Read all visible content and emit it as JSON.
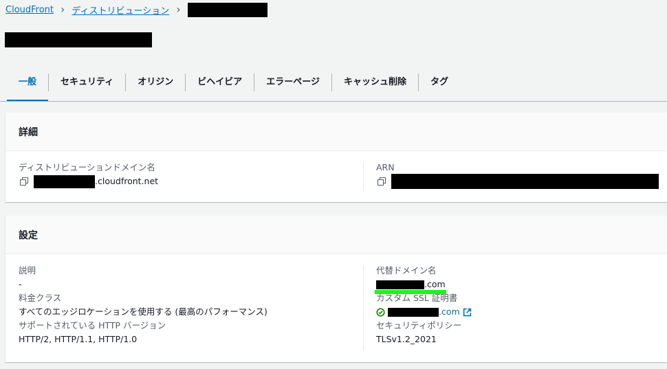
{
  "breadcrumb": {
    "root": "CloudFront",
    "section": "ディストリビューション"
  },
  "tabs": [
    {
      "label": "一般",
      "active": true
    },
    {
      "label": "セキュリティ"
    },
    {
      "label": "オリジン"
    },
    {
      "label": "ビヘイビア"
    },
    {
      "label": "エラーページ"
    },
    {
      "label": "キャッシュ削除"
    },
    {
      "label": "タグ"
    }
  ],
  "details": {
    "header": "詳細",
    "domain_label": "ディストリビューションドメイン名",
    "domain_suffix": ".cloudfront.net",
    "arn_label": "ARN"
  },
  "settings": {
    "header": "設定",
    "description_label": "説明",
    "description_value": "-",
    "price_class_label": "料金クラス",
    "price_class_value": "すべてのエッジロケーションを使用する (最高のパフォーマンス)",
    "http_label": "サポートされている HTTP バージョン",
    "http_value": "HTTP/2, HTTP/1.1, HTTP/1.0",
    "alt_domain_label": "代替ドメイン名",
    "alt_domain_suffix": ".com",
    "ssl_label": "カスタム SSL 証明書",
    "ssl_suffix": ".com",
    "policy_label": "セキュリティポリシー",
    "policy_value": "TLSv1.2_2021"
  },
  "colors": {
    "link": "#0073bb",
    "success": "#1d8102",
    "redaction": "#000000",
    "highlight": "#1df41d"
  },
  "icons": [
    "chevron-right-icon",
    "copy-icon",
    "check-circle-icon",
    "external-link-icon"
  ]
}
